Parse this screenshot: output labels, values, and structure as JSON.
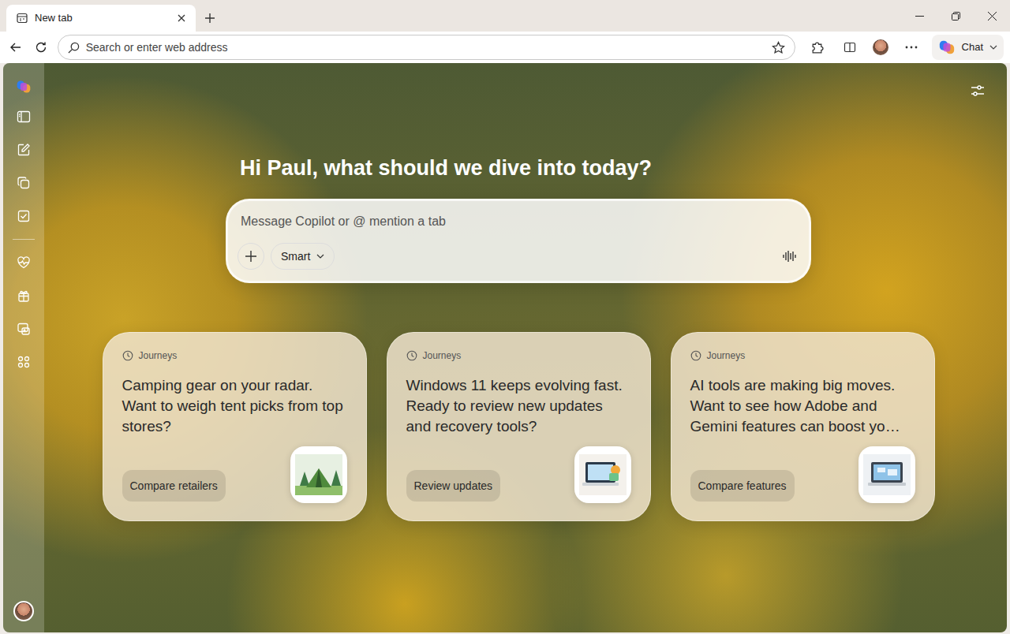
{
  "window": {
    "tab": {
      "label": "New tab",
      "selected": true
    }
  },
  "address_bar": {
    "placeholder": "Search or enter web address"
  },
  "toolbar": {
    "chat_label": "Chat"
  },
  "copilot": {
    "greeting": "Hi Paul, what should we dive into today?",
    "input_placeholder": "Message Copilot or @ mention a tab",
    "mode": "Smart"
  },
  "cards": [
    {
      "tag": "Journeys",
      "text": "Camping gear on your radar. Want to weigh tent picks from top stores?",
      "action": "Compare retailers"
    },
    {
      "tag": "Journeys",
      "text": "Windows 11 keeps evolving fast. Ready to review new updates and recovery tools?",
      "action": "Review updates"
    },
    {
      "tag": "Journeys",
      "text": "AI tools are making big moves. Want to see how Adobe and Gemini features can boost yo…",
      "action": "Compare features"
    }
  ]
}
